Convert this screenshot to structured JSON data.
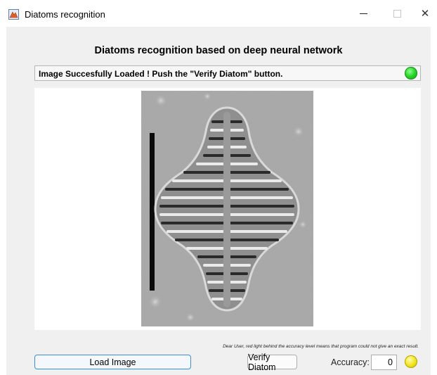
{
  "window": {
    "title": "Diatoms recognition",
    "icon": "matlab-figure-icon",
    "controls": [
      "minimize-icon",
      "maximize-icon",
      "close-icon"
    ],
    "close_symbol": "✕"
  },
  "main": {
    "heading": "Diatoms recognition based on deep neural network",
    "status_message": "Image Succesfully Loaded ! Push the \"Verify Diatom\" button.",
    "status_light_color": "#22cc22",
    "image_panel": {
      "content": "diatom micrograph with black scale bar",
      "background": "#ffffff"
    },
    "note": "Dear User, red light behind the accuracy level means that program could not give an exact result."
  },
  "controls": {
    "load_button_label": "Load Image",
    "verify_button_label": "Verify Diatom",
    "accuracy_label": "Accuracy:",
    "accuracy_value": "0",
    "accuracy_light_color": "#f0e020"
  }
}
